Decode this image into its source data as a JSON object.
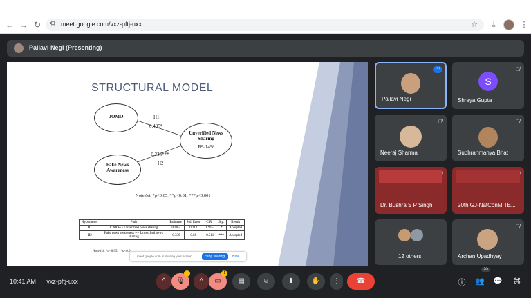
{
  "browser": {
    "url": "meet.google.com/vxz-pftj-uxx"
  },
  "presenter_bar": {
    "label": "Pallavi Negi (Presenting)"
  },
  "slide": {
    "title": "STRUCTURAL MODEL",
    "jomo": "JOMO",
    "fake_news": "Fake News Awareness",
    "unverified": "Unverified News Sharing",
    "r2": "R²=14%",
    "h1": "H1",
    "h1_val": "0.405*",
    "h2": "H2",
    "h2_val": "-0.336***",
    "note": "Note (s): *p<0.05, **p<0.01, ***p<0.001",
    "note2": "Note (s): *p<0.05, **p<0.0",
    "table": {
      "headers": [
        "Hypotheses",
        "Path",
        "Estimate",
        "Std. Error",
        "C.R.",
        "Sig.",
        "Result"
      ],
      "rows": [
        [
          "H1",
          "JOMO--> Unverified news sharing",
          "0.405",
          "0.212",
          "1.915",
          "*",
          "Accepted"
        ],
        [
          "H2",
          "Fake news awareness --> Unverified news sharing",
          "-0.336",
          "0.66",
          "-0.511",
          "***",
          "Accepted"
        ]
      ]
    }
  },
  "share_popup": {
    "text": "meet.google.com is sharing your screen.",
    "stop": "Stop sharing",
    "hide": "Hide"
  },
  "participants": [
    {
      "name": "Pallavi Negi"
    },
    {
      "name": "Shreya Gupta",
      "initial": "S"
    },
    {
      "name": "Neeraj Sharma"
    },
    {
      "name": "Subhrahmanya Bhat"
    },
    {
      "name": "Dr. Bushra S P Singh"
    },
    {
      "name": "20th GJ-NatConMITE..."
    },
    {
      "name": "12 others"
    },
    {
      "name": "Archan Upadhyay"
    }
  ],
  "bottom": {
    "time": "10:41 AM",
    "sep": "|",
    "code": "vxz-pftj-uxx",
    "participant_count": "20",
    "badge1": "!",
    "badge2": "!"
  },
  "colors": {
    "accent": "#1a73e8",
    "end_call": "#ea4335",
    "tile_bg": "#3c4043"
  }
}
